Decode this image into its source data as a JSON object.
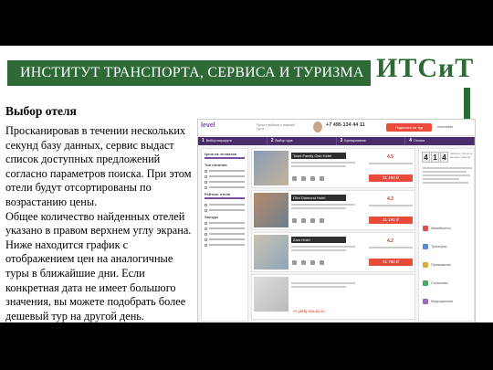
{
  "slide": {
    "header_title": "ИНСТИТУТ ТРАНСПОРТА, СЕРВИСА И ТУРИЗМА",
    "logo_text": "ИТСиТ",
    "section_title": "Выбор отеля",
    "paragraphs": [
      "Просканировав в течении нескольких секунд базу данных, сервис выдаст список доступных предложений согласно параметров поиска. При этом отели будут отсортированы по возрастанию цены.",
      "Общее количество найденных отелей указано в правом верхнем углу экрана. Ниже находится график с отображением цен на аналогичные туры в ближайшие дни. Если конкретная дата не имеет большого значения, вы можете подобрать более дешевый тур на другой день."
    ]
  },
  "site": {
    "logo": "level",
    "tagline": "Просто выбери и покупай тур в ...",
    "phone": "+7 495 134 44 11",
    "cta_button": "Подписка на тур",
    "user": "vkontakte",
    "steps": [
      {
        "num": "1",
        "label": "Выбор маршрута"
      },
      {
        "num": "2",
        "label": "Выбор тура"
      },
      {
        "num": "3",
        "label": "Бронирование"
      },
      {
        "num": "4",
        "label": "Оплата"
      }
    ],
    "filters": {
      "price_title": "Цена на человека",
      "type_title": "Тип питания",
      "rating_title": "Рейтинг отеля",
      "stars_title": "Звезды"
    },
    "hotels": [
      {
        "name": "Tosei Family Club Hotel",
        "rating": "4.5",
        "price": "31 190 ₽",
        "colors": [
          "#8a9cb8",
          "#c4b49a"
        ]
      },
      {
        "name": "Olivi Diamond Hotel",
        "rating": "4.3",
        "price": "31 190 ₽",
        "colors": [
          "#b58a6a",
          "#6e7f8e"
        ]
      },
      {
        "name": "Zoro Hotel",
        "rating": "4.2",
        "price": "31 790 ₽",
        "colors": [
          "#c9c2b2",
          "#8fa6b9"
        ]
      }
    ],
    "counter_digits": [
      "4",
      "1",
      "4"
    ],
    "counter_label": "найдено туров по вашему запросу",
    "services": [
      {
        "label": "Авиабилеты",
        "color": "#d9534f"
      },
      {
        "label": "Трансфер",
        "color": "#5b8bd0"
      },
      {
        "label": "Проживание",
        "color": "#e0a53c"
      },
      {
        "label": "Страховка",
        "color": "#4aa86a"
      },
      {
        "label": "Медицинская",
        "color": "#9b6bbf"
      }
    ],
    "footer_phone": "+7 (495) 134-44-11"
  }
}
